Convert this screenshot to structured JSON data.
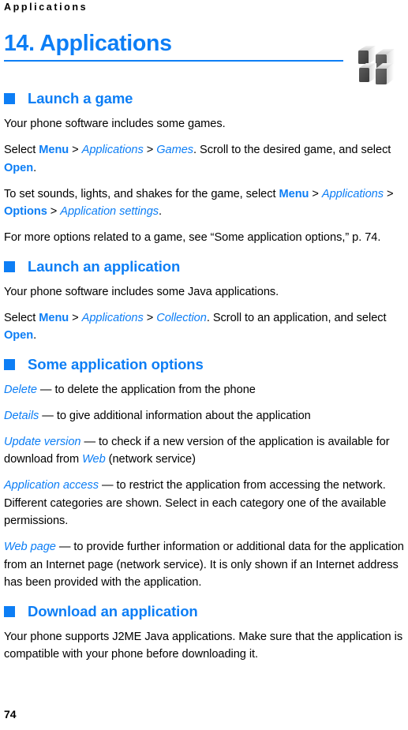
{
  "page": {
    "running_header": "Applications",
    "chapter_title": "14. Applications",
    "page_number": "74",
    "accent_color": "#0d7ef5",
    "text_color": "#000000",
    "icon_name": "applications-cubes-icon"
  },
  "sections": [
    {
      "heading": "Launch a game",
      "paragraphs": [
        {
          "runs": [
            {
              "text": "Your phone software includes some games.",
              "style": "plain"
            }
          ]
        },
        {
          "runs": [
            {
              "text": "Select ",
              "style": "plain"
            },
            {
              "text": "Menu",
              "style": "bold-accent"
            },
            {
              "text": " > ",
              "style": "plain"
            },
            {
              "text": "Applications",
              "style": "italic-accent"
            },
            {
              "text": " > ",
              "style": "plain"
            },
            {
              "text": "Games",
              "style": "italic-accent"
            },
            {
              "text": ". Scroll to the desired game, and select ",
              "style": "plain"
            },
            {
              "text": "Open",
              "style": "bold-accent"
            },
            {
              "text": ".",
              "style": "plain"
            }
          ]
        },
        {
          "runs": [
            {
              "text": "To set sounds, lights, and shakes for the game, select ",
              "style": "plain"
            },
            {
              "text": "Menu",
              "style": "bold-accent"
            },
            {
              "text": " > ",
              "style": "plain"
            },
            {
              "text": "Applications",
              "style": "italic-accent"
            },
            {
              "text": " > ",
              "style": "plain"
            },
            {
              "text": "Options",
              "style": "bold-accent"
            },
            {
              "text": " > ",
              "style": "plain"
            },
            {
              "text": "Application settings",
              "style": "italic-accent"
            },
            {
              "text": ".",
              "style": "plain"
            }
          ]
        },
        {
          "runs": [
            {
              "text": "For more options related to a game, see “Some application options,” p. 74.",
              "style": "plain"
            }
          ]
        }
      ]
    },
    {
      "heading": "Launch an application",
      "paragraphs": [
        {
          "runs": [
            {
              "text": "Your phone software includes some Java applications.",
              "style": "plain"
            }
          ]
        },
        {
          "runs": [
            {
              "text": "Select ",
              "style": "plain"
            },
            {
              "text": "Menu",
              "style": "bold-accent"
            },
            {
              "text": " > ",
              "style": "plain"
            },
            {
              "text": "Applications",
              "style": "italic-accent"
            },
            {
              "text": " > ",
              "style": "plain"
            },
            {
              "text": "Collection",
              "style": "italic-accent"
            },
            {
              "text": ". Scroll to an application, and select ",
              "style": "plain"
            },
            {
              "text": "Open",
              "style": "bold-accent"
            },
            {
              "text": ".",
              "style": "plain"
            }
          ]
        }
      ]
    },
    {
      "heading": "Some application options",
      "paragraphs": [
        {
          "runs": [
            {
              "text": "Delete",
              "style": "italic-accent"
            },
            {
              "text": " — to delete the application from the phone",
              "style": "plain"
            }
          ]
        },
        {
          "runs": [
            {
              "text": "Details",
              "style": "italic-accent"
            },
            {
              "text": " — to give additional information about the application",
              "style": "plain"
            }
          ]
        },
        {
          "runs": [
            {
              "text": "Update version",
              "style": "italic-accent"
            },
            {
              "text": " — to check if a new version of the application is available for download from ",
              "style": "plain"
            },
            {
              "text": "Web",
              "style": "italic-accent"
            },
            {
              "text": " (network service)",
              "style": "plain"
            }
          ]
        },
        {
          "runs": [
            {
              "text": "Application access",
              "style": "italic-accent"
            },
            {
              "text": " — to restrict the application from accessing the network. Different categories are shown. Select in each category one of the available permissions.",
              "style": "plain"
            }
          ]
        },
        {
          "runs": [
            {
              "text": "Web page",
              "style": "italic-accent"
            },
            {
              "text": " — to provide further information or additional data for the application from an Internet page (network service). It is only shown if an Internet address has been provided with the application.",
              "style": "plain"
            }
          ]
        }
      ]
    },
    {
      "heading": "Download an application",
      "paragraphs": [
        {
          "runs": [
            {
              "text": "Your phone supports J2ME Java applications. Make sure that the application is compatible with your phone before downloading it.",
              "style": "plain"
            }
          ]
        }
      ]
    }
  ]
}
